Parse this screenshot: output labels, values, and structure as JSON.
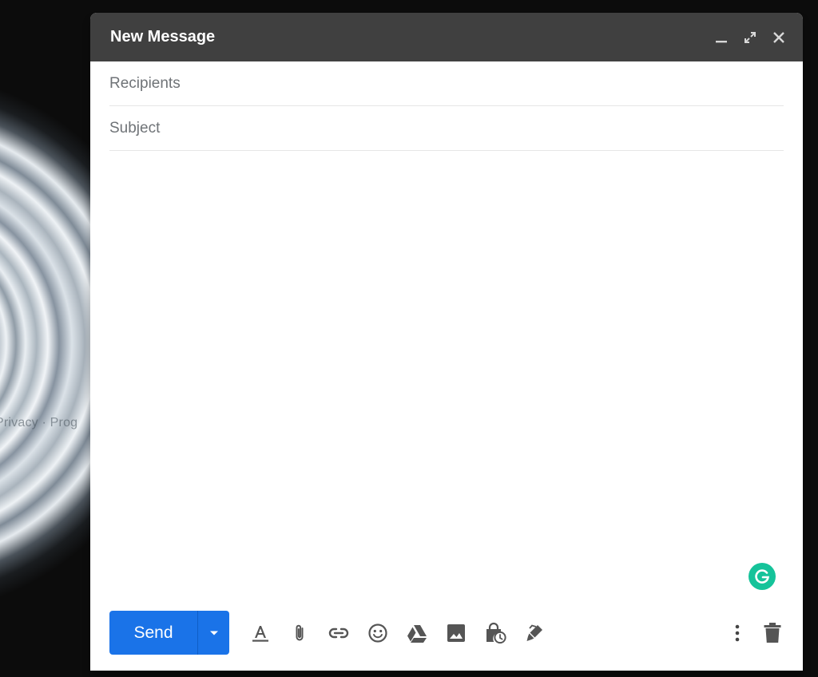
{
  "background": {
    "footer_text": "Privacy · Prog"
  },
  "compose": {
    "title": "New Message",
    "recipients_placeholder": "Recipients",
    "subject_placeholder": "Subject",
    "send_label": "Send",
    "colors": {
      "header": "#404040",
      "send": "#1a73e8",
      "grammarly": "#15c39a"
    },
    "header_icons": [
      "minimize-icon",
      "fullscreen-icon",
      "close-icon"
    ],
    "toolbar_icons": [
      "formatting-options-icon",
      "attach-file-icon",
      "insert-link-icon",
      "insert-emoji-icon",
      "google-drive-icon",
      "insert-photo-icon",
      "confidential-mode-icon",
      "insert-signature-icon",
      "more-options-icon",
      "discard-draft-icon"
    ]
  }
}
